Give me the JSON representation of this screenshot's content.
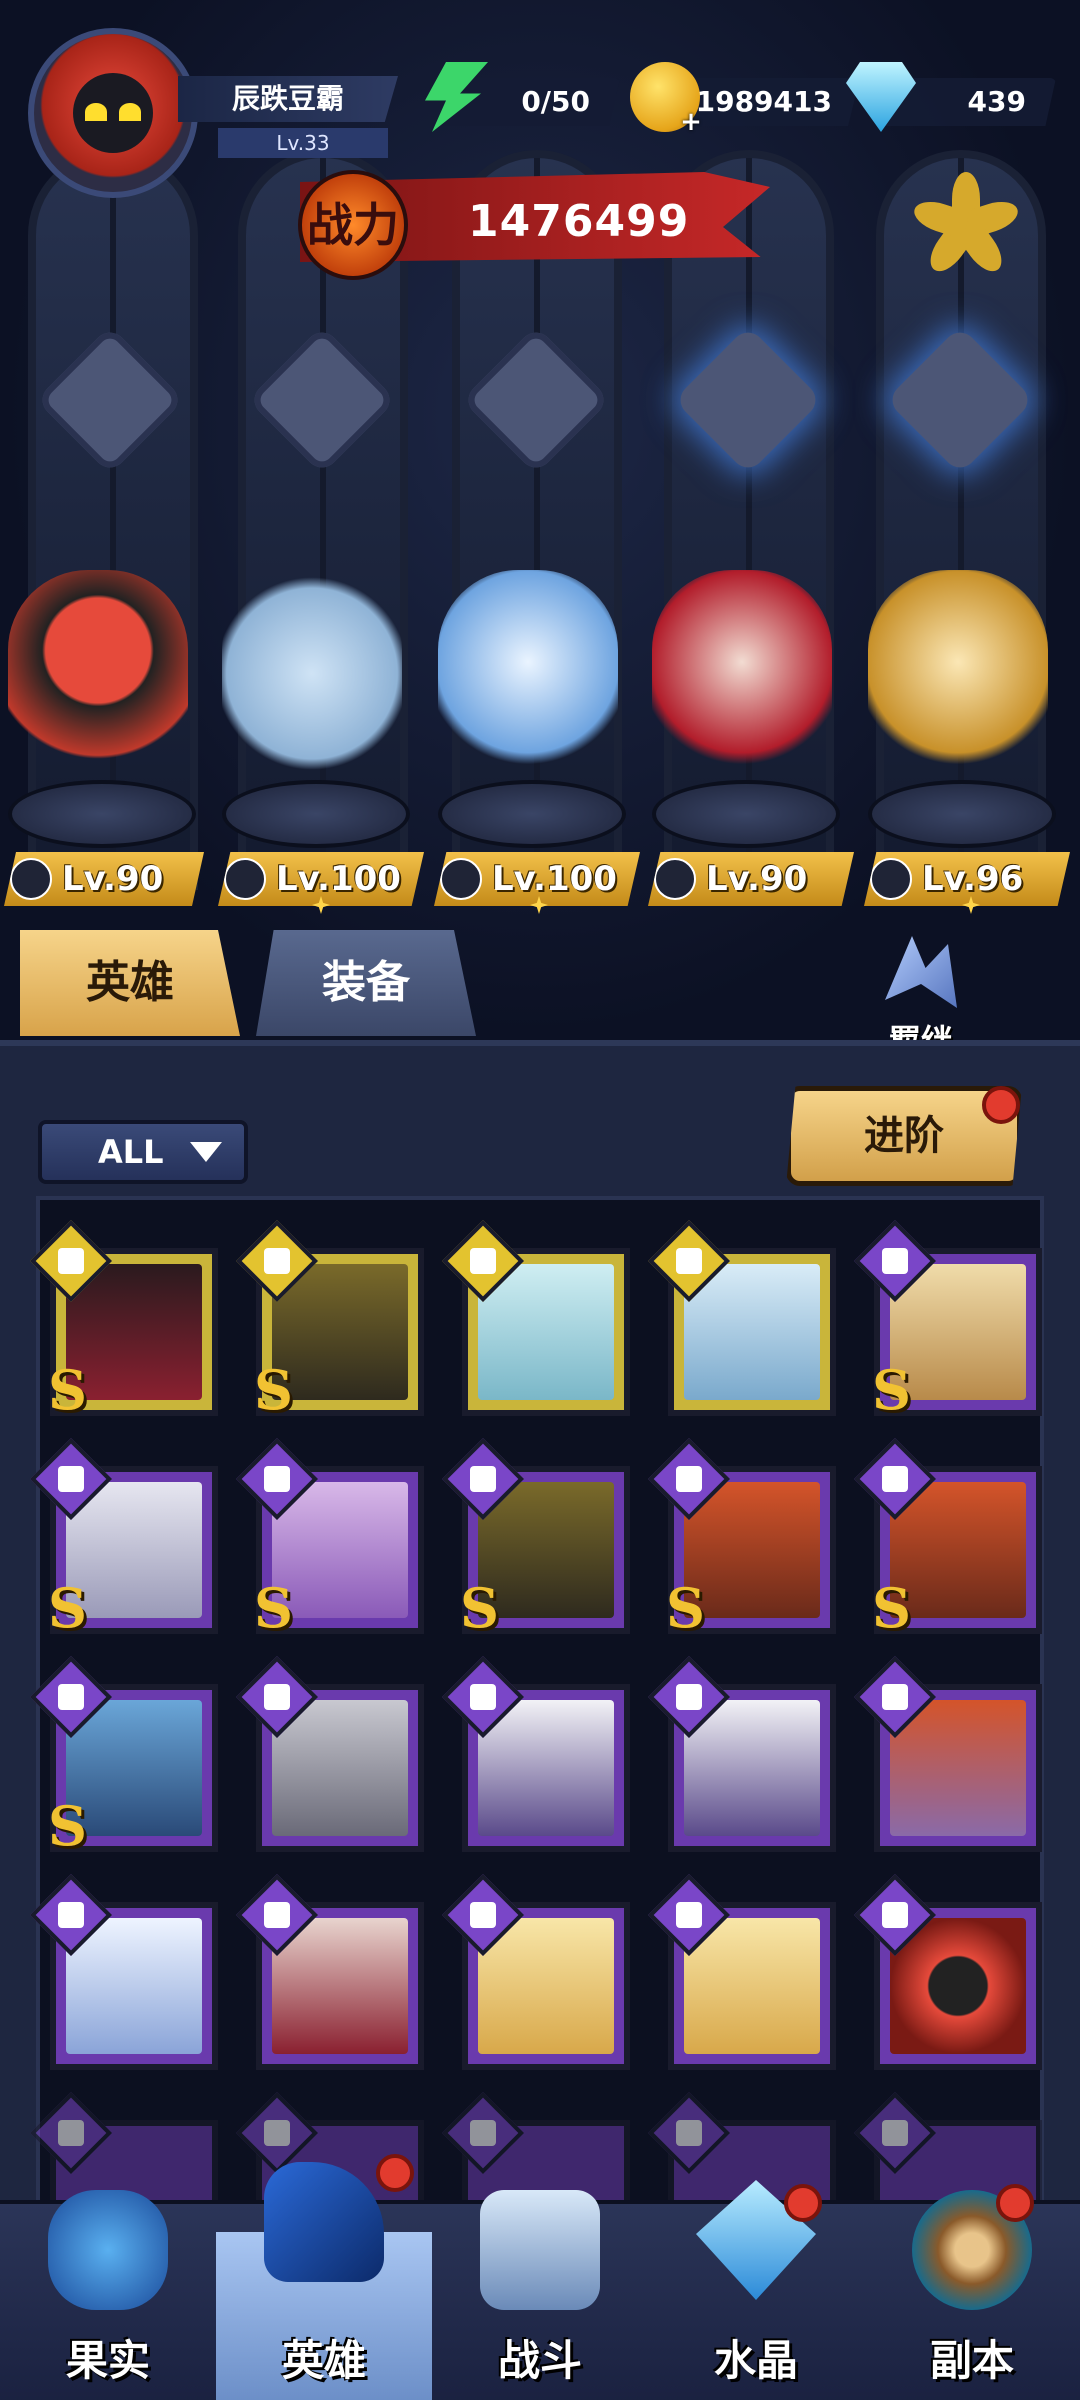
{
  "player": {
    "name": "辰跌豆霸",
    "level": "Lv.33"
  },
  "resources": {
    "stamina": "0/50",
    "gold": "1989413",
    "diamond": "439"
  },
  "power": {
    "label": "战力",
    "value": "1476499"
  },
  "heroes": [
    {
      "level": "Lv.90",
      "class_icon": "wrench-icon"
    },
    {
      "level": "Lv.100",
      "class_icon": "beast-claw-icon"
    },
    {
      "level": "Lv.100",
      "class_icon": "mage-hat-icon"
    },
    {
      "level": "Lv.90",
      "class_icon": "wing-icon"
    },
    {
      "level": "Lv.96",
      "class_icon": "wing-icon"
    }
  ],
  "tabs": {
    "hero": "英雄",
    "equipment": "装备",
    "bond": "羁绊"
  },
  "filter": {
    "selected": "ALL"
  },
  "advance_button": "进阶",
  "grid_rank_label": "S",
  "nav": {
    "fruit": "果实",
    "hero": "英雄",
    "battle": "战斗",
    "crystal": "水晶",
    "dungeon": "副本"
  },
  "colors": {
    "gold_frame": "#c9b53a",
    "purple_frame": "#6a3aad",
    "accent_red": "#e23b2e",
    "power_red": "#c62828"
  }
}
